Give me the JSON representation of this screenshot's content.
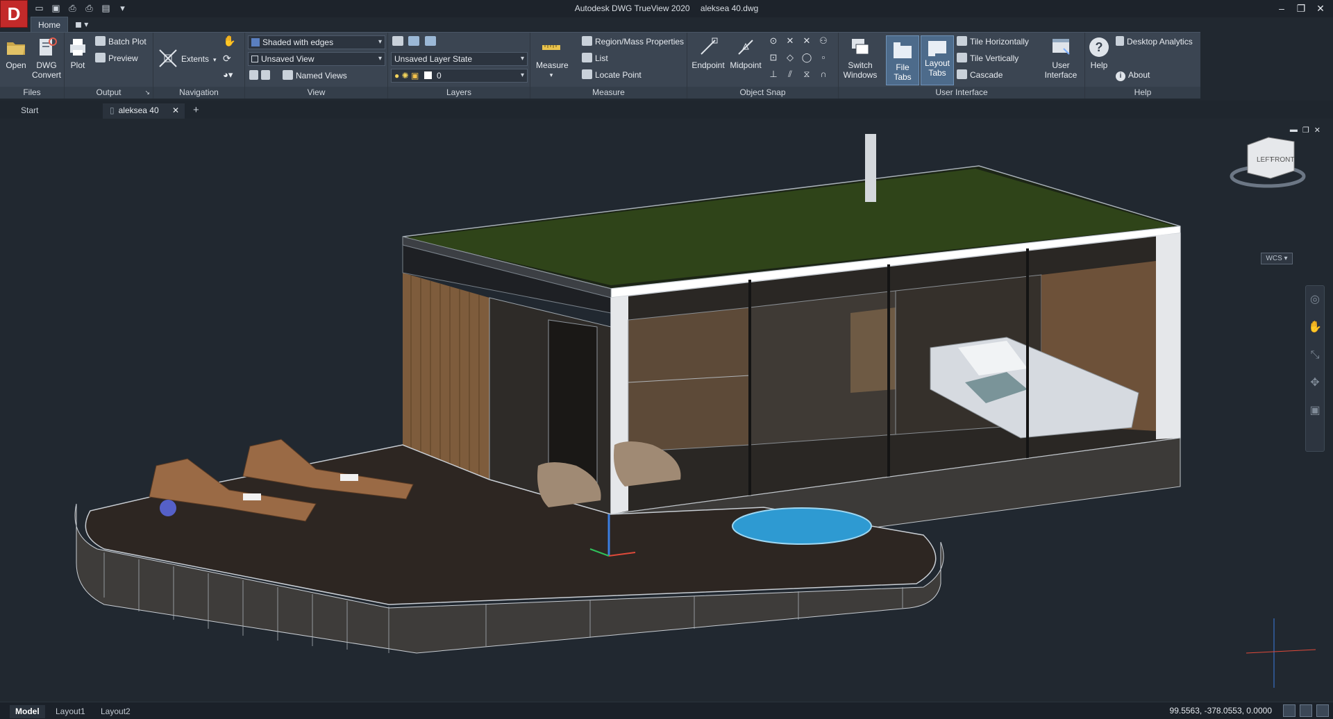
{
  "app": {
    "logo": "D",
    "title": "Autodesk DWG TrueView 2020",
    "file": "aleksea 40.dwg"
  },
  "ribbon": {
    "tabs": [
      "Home"
    ],
    "files": {
      "title": "Files",
      "open": "Open",
      "dwg_convert_1": "DWG",
      "dwg_convert_2": "Convert"
    },
    "output": {
      "title": "Output",
      "plot": "Plot",
      "batch_plot": "Batch Plot",
      "preview": "Preview"
    },
    "navigation": {
      "title": "Navigation",
      "extents": "Extents"
    },
    "view": {
      "title": "View",
      "visual_style": "Shaded with edges",
      "named_view": "Unsaved View",
      "named_views": "Named Views"
    },
    "layers": {
      "title": "Layers",
      "layer_state": "Unsaved Layer State",
      "current_layer": "0"
    },
    "measure": {
      "title": "Measure",
      "measure": "Measure",
      "region_mass": "Region/Mass Properties",
      "list": "List",
      "locate_point": "Locate Point"
    },
    "object_snap": {
      "title": "Object Snap",
      "endpoint": "Endpoint",
      "midpoint": "Midpoint"
    },
    "user_interface": {
      "title": "User Interface",
      "switch_windows_1": "Switch",
      "switch_windows_2": "Windows",
      "file_tabs_1": "File Tabs",
      "layout_tabs_1": "Layout",
      "layout_tabs_2": "Tabs",
      "tile_h": "Tile Horizontally",
      "tile_v": "Tile Vertically",
      "cascade": "Cascade",
      "user_interface_1": "User",
      "user_interface_2": "Interface"
    },
    "help": {
      "title": "Help",
      "help": "Help",
      "desktop_analytics": "Desktop Analytics",
      "about": "About"
    }
  },
  "file_tabs": [
    {
      "label": "Start"
    },
    {
      "label": "aleksea 40"
    }
  ],
  "viewcube": {
    "left": "LEFT",
    "front": "FRONT"
  },
  "wcs_label": "WCS",
  "layout_tabs": [
    "Model",
    "Layout1",
    "Layout2"
  ],
  "status": {
    "coords": "99.5563, -378.0553, 0.0000"
  },
  "colors": {
    "titlebar": "#1d232b",
    "ribbon": "#3b4552",
    "viewport": "#212830",
    "accent": "#c32a2a"
  }
}
